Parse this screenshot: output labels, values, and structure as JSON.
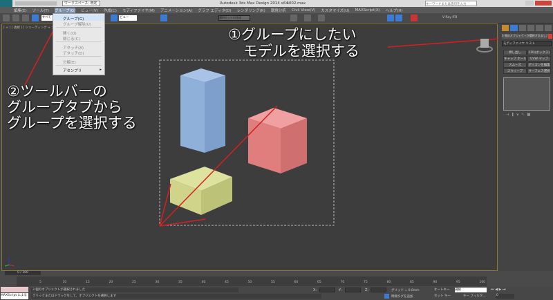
{
  "title_bar": {
    "workspace": "ワークスペース: 既定",
    "app_title": "Autodesk 3ds Max Design 2014 x64",
    "file_name": "s002.max",
    "search_placeholder": "キーワードまたは語句を入力"
  },
  "menubar": [
    "編集(E)",
    "ツール(T)",
    "グループ(G)",
    "ビュー(V)",
    "作成(C)",
    "モディファイヤ(M)",
    "アニメーション(A)",
    "グラフ エディタ(D)",
    "レンダリング(R)",
    "環境分析",
    "Civil View(V)",
    "カスタマイズ(U)",
    "MAXScript(X)",
    "ヘルプ(H)"
  ],
  "toolbar": {
    "filter": "すべて",
    "view": "ビュー",
    "selection_set": "選択セットの作成",
    "vray": "V-Ray IFB"
  },
  "group_menu": {
    "items": [
      {
        "label": "グループ(G)",
        "enabled": true
      },
      {
        "label": "グループ解除(U)",
        "enabled": false
      },
      {
        "label": "開く(O)",
        "enabled": false
      },
      {
        "label": "閉じる(C)",
        "enabled": false
      },
      {
        "label": "アタッチ(A)",
        "enabled": false
      },
      {
        "label": "デタッチ(D)",
        "enabled": false
      },
      {
        "label": "分解(E)",
        "enabled": false
      },
      {
        "label": "アセンブリ",
        "enabled": true,
        "submenu": true
      }
    ]
  },
  "viewport": {
    "label": "[ + ] [ 透視 ] [ シェーディング + エッジ面 ]"
  },
  "callouts": {
    "c1_line1": "①グループにしたい",
    "c1_line2": "モデルを選択する",
    "c2_line1": "②ツールバーの",
    "c2_line2": "グループタブから",
    "c2_line3": "グループを選択する"
  },
  "command_panel": {
    "selection_name": "3 個のオブジェクトが選択されました",
    "modifier_list": "モディファイヤ リスト",
    "buttons": [
      "押し出し",
      "FFD(ボックス)",
      "キャップ ホール",
      "UVW マップ",
      "スムーズ",
      "ポリゴンを編集",
      "スウィープ",
      "サーフェス選択"
    ]
  },
  "timeline": {
    "frame": "0 / 100",
    "ticks": [
      "5",
      "10",
      "15",
      "20",
      "25",
      "30",
      "35",
      "40",
      "45",
      "50",
      "55",
      "60",
      "65",
      "70",
      "75",
      "80",
      "85",
      "90",
      "95",
      "100"
    ]
  },
  "status": {
    "maxscript": "MAXScript による",
    "message1": "3 個のオブジェクトが選択されました",
    "message2": "クリックまたはドラッグをして、オブジェクトを選択します",
    "x_label": "X:",
    "y_label": "Y:",
    "z_label": "Z:",
    "grid": "グリッド = 0.0mm",
    "add_time_tag": "時間タグを追加",
    "autokey": "オートキー",
    "setkey": "セット キー",
    "selected": "選択",
    "key_filter": "キー フィルタ...",
    "frame_value": "0"
  },
  "colors": {
    "accent_red": "#d42020",
    "box_blue": "#8fb0d8",
    "box_red": "#e07e7e",
    "box_yellow": "#cfd48a",
    "viewport_border": "#8a7a35"
  }
}
